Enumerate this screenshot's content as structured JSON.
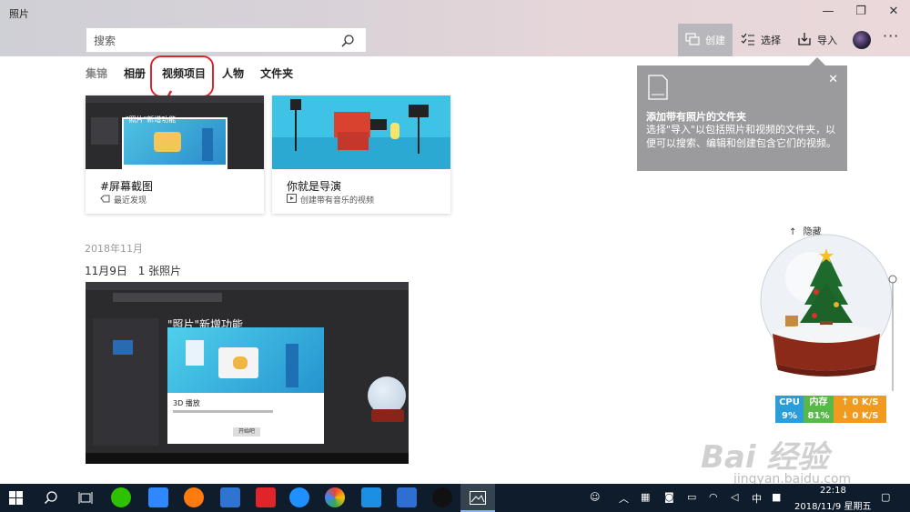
{
  "app": {
    "title": "照片"
  },
  "window_controls": {
    "minimize": "—",
    "maximize": "❐",
    "close": "✕"
  },
  "search": {
    "placeholder": "搜索"
  },
  "commands": {
    "create": "创建",
    "select": "选择",
    "import": "导入",
    "more": "···"
  },
  "tabs": [
    {
      "label": "集锦",
      "active": false
    },
    {
      "label": "相册",
      "active": false
    },
    {
      "label": "视频项目",
      "active": true
    },
    {
      "label": "人物",
      "active": false
    },
    {
      "label": "文件夹",
      "active": false
    }
  ],
  "cards": [
    {
      "title": "#屏幕截图",
      "subtitle": "最近发现",
      "thumb_overlay": "\"照片\"新增功能"
    },
    {
      "title": "你就是导演",
      "subtitle": "创建带有音乐的视频"
    }
  ],
  "timeline": {
    "month": "2018年11月",
    "day": "11月9日",
    "count": "1 张照片",
    "preview": {
      "dialog_title": "\"照片\"新增功能",
      "dialog_heading": "3D 播放",
      "dialog_button": "开始吧"
    }
  },
  "tooltip": {
    "title": "添加带有照片的文件夹",
    "body": "选择\"导入\"以包括照片和视频的文件夹，以便可以搜索、编辑和创建包含它们的视频。"
  },
  "widget": {
    "hide_label": "隐藏",
    "cpu_label": "CPU",
    "cpu_value": "9%",
    "mem_label": "内存",
    "mem_value": "81%",
    "up": "0 K/S",
    "down": "0 K/S"
  },
  "watermark": {
    "brand": "Bai 经验",
    "url": "jingyan.baidu.com"
  },
  "taskbar": {
    "ime": "中",
    "time": "22:18",
    "date": "2018/11/9 星期五"
  },
  "colors": {
    "accent_red": "#e0252a",
    "taskbar": "#0f1c2b",
    "tooltip_bg": "#9b9b9d"
  }
}
